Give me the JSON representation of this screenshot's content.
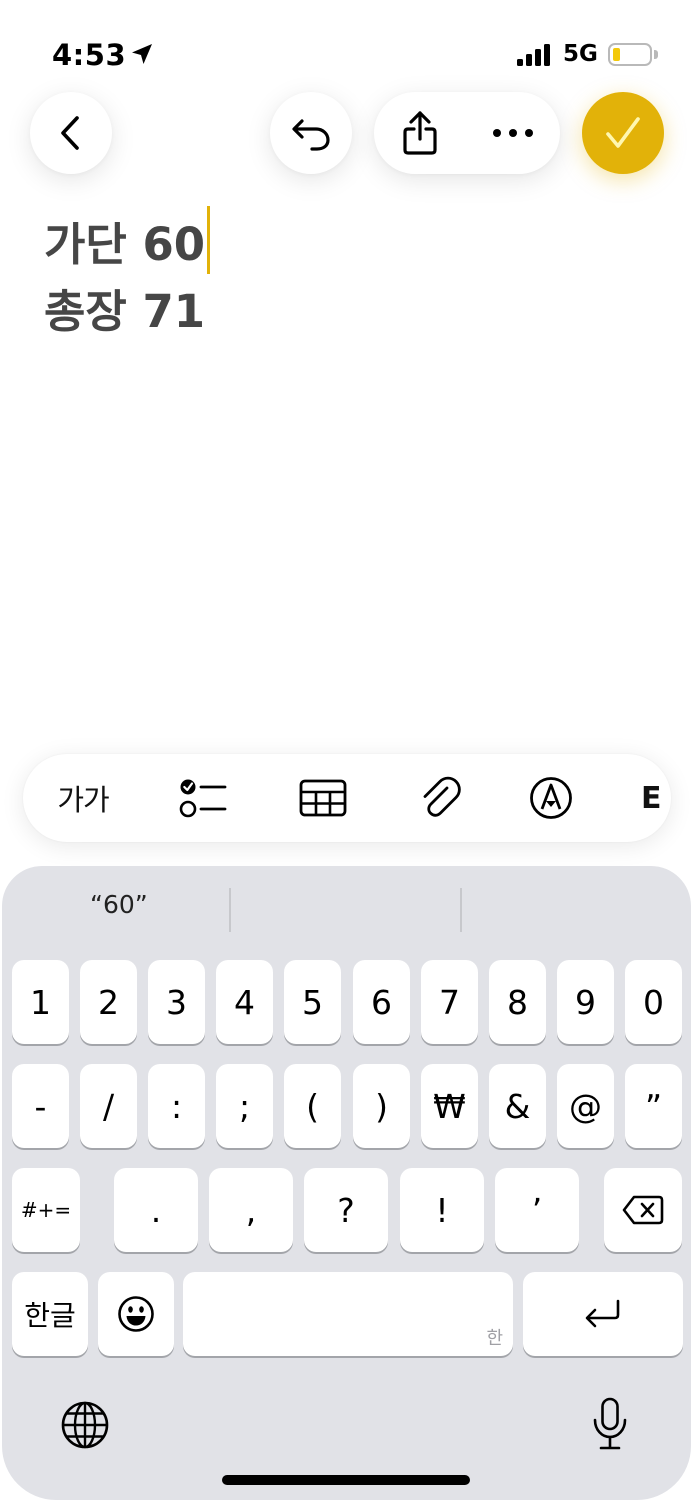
{
  "status": {
    "time": "4:53",
    "network": "5G",
    "battery_color": "#f3c90b"
  },
  "toolbar": {
    "back_icon": "chevron-left-icon",
    "undo_icon": "undo-icon",
    "share_icon": "share-icon",
    "more_icon": "ellipsis-icon",
    "done_icon": "checkmark-icon",
    "accent_color": "#e2b209"
  },
  "note": {
    "lines": [
      "가단 60",
      "총장 71"
    ]
  },
  "format_bar": {
    "text_style_label": "가가",
    "partial_label": "E",
    "icons": [
      "checklist-icon",
      "table-icon",
      "paperclip-icon",
      "markup-pen-icon"
    ]
  },
  "keyboard": {
    "suggestion": "“60”",
    "row1": [
      "1",
      "2",
      "3",
      "4",
      "5",
      "6",
      "7",
      "8",
      "9",
      "0"
    ],
    "row2": [
      "-",
      "/",
      ":",
      ";",
      "(",
      ")",
      "₩",
      "&",
      "@",
      "”"
    ],
    "row3_toggle": "#+=",
    "row3": [
      ".",
      ",",
      "?",
      "!",
      "’"
    ],
    "lang_key": "한글",
    "space_hint": "한",
    "emoji_icon": "emoji-icon",
    "delete_icon": "delete-icon",
    "return_icon": "return-icon",
    "globe_icon": "globe-icon",
    "mic_icon": "microphone-icon"
  }
}
